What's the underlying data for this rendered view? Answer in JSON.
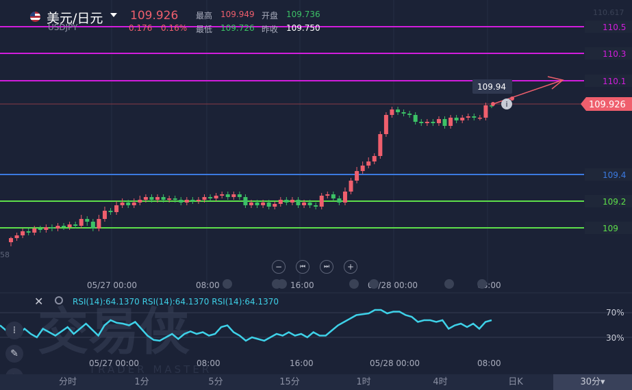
{
  "header": {
    "pair": "美元/日元",
    "symbol": "USDJPY",
    "price": "109.926",
    "change": "0.176",
    "change_pct": "0.16%",
    "high_label": "最高",
    "high_value": "109.949",
    "open_label": "开盘",
    "open_value": "109.736",
    "low_label": "最低",
    "low_value": "109.726",
    "prev_close_label": "昨收",
    "prev_close_value": "109.750"
  },
  "levels": [
    {
      "label": "110.5",
      "color": "#d21ddd"
    },
    {
      "label": "110.3",
      "color": "#d21ddd"
    },
    {
      "label": "110.1",
      "color": "#d21ddd"
    },
    {
      "label": "109.4",
      "color": "#3b7ae0"
    },
    {
      "label": "109.2",
      "color": "#5ee04a"
    },
    {
      "label": "109",
      "color": "#5ee04a"
    }
  ],
  "top_partial_label": "110.617",
  "left_partial_label": "58",
  "current_price_badge": "109.926",
  "arrow_tooltip": "109.94",
  "time_axis_main": [
    "05/27 00:00",
    "08:00",
    "16:00",
    "05/28 00:00",
    "08:00"
  ],
  "time_axis_rsi": [
    "05/27 00:00",
    "08:00",
    "16:00",
    "05/28 00:00",
    "08:00"
  ],
  "rsi": {
    "legend": [
      "RSI(14):64.1370",
      "RSI(14):64.1370",
      "RSI(14):64.1370"
    ],
    "level_70": "70%",
    "level_30": "30%"
  },
  "zoom_controls": {
    "zoom_out": "−",
    "prev": "⏮",
    "next": "⏭",
    "zoom_in": "+"
  },
  "watermark": {
    "main": "交易侠",
    "sub": "TRADER MASTER"
  },
  "tabs": [
    {
      "label": "分时"
    },
    {
      "label": "1分"
    },
    {
      "label": "5分"
    },
    {
      "label": "15分"
    },
    {
      "label": "1时"
    },
    {
      "label": "4时"
    },
    {
      "label": "日K"
    },
    {
      "label": "30分▾",
      "active": true
    }
  ],
  "chart_data": {
    "type": "candlestick",
    "y_range": [
      108.95,
      110.62
    ],
    "rsi_range": [
      20,
      100
    ],
    "candles": [
      [
        108.93,
        108.96,
        108.9,
        108.97
      ],
      [
        108.96,
        108.98,
        108.94,
        109.0
      ],
      [
        108.98,
        109.01,
        108.96,
        109.03
      ],
      [
        109.01,
        109.0,
        108.98,
        109.03
      ],
      [
        109.0,
        109.03,
        108.98,
        109.05
      ],
      [
        109.03,
        109.02,
        109.0,
        109.05
      ],
      [
        109.02,
        109.04,
        109.0,
        109.06
      ],
      [
        109.04,
        109.03,
        109.01,
        109.06
      ],
      [
        109.03,
        109.05,
        109.01,
        109.07
      ],
      [
        109.05,
        109.04,
        109.02,
        109.07
      ],
      [
        109.04,
        109.06,
        109.02,
        109.08
      ],
      [
        109.06,
        109.05,
        109.03,
        109.08
      ],
      [
        109.05,
        109.1,
        109.03,
        109.13
      ],
      [
        109.1,
        109.08,
        109.05,
        109.12
      ],
      [
        109.08,
        109.03,
        109.01,
        109.1
      ],
      [
        109.03,
        109.1,
        109.01,
        109.13
      ],
      [
        109.1,
        109.16,
        109.08,
        109.19
      ],
      [
        109.16,
        109.15,
        109.13,
        109.18
      ],
      [
        109.15,
        109.2,
        109.13,
        109.23
      ],
      [
        109.2,
        109.22,
        109.18,
        109.25
      ],
      [
        109.22,
        109.2,
        109.18,
        109.24
      ],
      [
        109.2,
        109.22,
        109.18,
        109.25
      ],
      [
        109.22,
        109.24,
        109.2,
        109.27
      ],
      [
        109.24,
        109.26,
        109.22,
        109.28
      ],
      [
        109.26,
        109.24,
        109.22,
        109.28
      ],
      [
        109.24,
        109.26,
        109.22,
        109.28
      ],
      [
        109.26,
        109.24,
        109.22,
        109.28
      ],
      [
        109.24,
        109.25,
        109.22,
        109.27
      ],
      [
        109.25,
        109.24,
        109.22,
        109.27
      ],
      [
        109.24,
        109.22,
        109.2,
        109.26
      ],
      [
        109.22,
        109.24,
        109.2,
        109.26
      ],
      [
        109.24,
        109.23,
        109.21,
        109.26
      ],
      [
        109.23,
        109.24,
        109.21,
        109.26
      ],
      [
        109.24,
        109.26,
        109.22,
        109.28
      ],
      [
        109.26,
        109.25,
        109.23,
        109.28
      ],
      [
        109.25,
        109.27,
        109.23,
        109.29
      ],
      [
        109.27,
        109.28,
        109.25,
        109.3
      ],
      [
        109.28,
        109.26,
        109.24,
        109.3
      ],
      [
        109.26,
        109.28,
        109.24,
        109.3
      ],
      [
        109.28,
        109.26,
        109.24,
        109.3
      ],
      [
        109.26,
        109.2,
        109.18,
        109.28
      ],
      [
        109.2,
        109.22,
        109.18,
        109.24
      ],
      [
        109.22,
        109.2,
        109.18,
        109.24
      ],
      [
        109.2,
        109.22,
        109.18,
        109.24
      ],
      [
        109.22,
        109.19,
        109.17,
        109.24
      ],
      [
        109.19,
        109.21,
        109.17,
        109.23
      ],
      [
        109.21,
        109.24,
        109.19,
        109.26
      ],
      [
        109.24,
        109.22,
        109.2,
        109.26
      ],
      [
        109.22,
        109.24,
        109.2,
        109.26
      ],
      [
        109.24,
        109.2,
        109.18,
        109.26
      ],
      [
        109.2,
        109.22,
        109.18,
        109.24
      ],
      [
        109.22,
        109.2,
        109.18,
        109.24
      ],
      [
        109.2,
        109.19,
        109.17,
        109.22
      ],
      [
        109.19,
        109.27,
        109.17,
        109.29
      ],
      [
        109.27,
        109.28,
        109.25,
        109.3
      ],
      [
        109.28,
        109.25,
        109.23,
        109.3
      ],
      [
        109.25,
        109.22,
        109.2,
        109.27
      ],
      [
        109.22,
        109.3,
        109.2,
        109.33
      ],
      [
        109.3,
        109.38,
        109.28,
        109.4
      ],
      [
        109.38,
        109.45,
        109.36,
        109.48
      ],
      [
        109.45,
        109.49,
        109.43,
        109.52
      ],
      [
        109.49,
        109.52,
        109.47,
        109.55
      ],
      [
        109.52,
        109.56,
        109.5,
        109.58
      ],
      [
        109.56,
        109.72,
        109.54,
        109.74
      ],
      [
        109.72,
        109.86,
        109.7,
        109.88
      ],
      [
        109.86,
        109.9,
        109.84,
        109.92
      ],
      [
        109.9,
        109.88,
        109.86,
        109.92
      ],
      [
        109.88,
        109.87,
        109.85,
        109.9
      ],
      [
        109.87,
        109.86,
        109.84,
        109.89
      ],
      [
        109.86,
        109.81,
        109.79,
        109.88
      ],
      [
        109.81,
        109.8,
        109.78,
        109.83
      ],
      [
        109.8,
        109.81,
        109.78,
        109.83
      ],
      [
        109.81,
        109.8,
        109.78,
        109.83
      ],
      [
        109.8,
        109.83,
        109.78,
        109.85
      ],
      [
        109.83,
        109.78,
        109.76,
        109.85
      ],
      [
        109.78,
        109.84,
        109.76,
        109.86
      ],
      [
        109.84,
        109.82,
        109.8,
        109.86
      ],
      [
        109.82,
        109.84,
        109.8,
        109.86
      ],
      [
        109.84,
        109.85,
        109.82,
        109.87
      ],
      [
        109.85,
        109.84,
        109.82,
        109.87
      ],
      [
        109.84,
        109.84,
        109.82,
        109.86
      ],
      [
        109.84,
        109.93,
        109.82,
        109.95
      ],
      [
        109.93,
        109.926,
        109.91,
        109.949
      ]
    ],
    "rsi_values": [
      62,
      56,
      48,
      52,
      58,
      52,
      48,
      58,
      54,
      50,
      55,
      60,
      52,
      58,
      64,
      57,
      50,
      62,
      68,
      65,
      64,
      62,
      66,
      58,
      50,
      45,
      44,
      48,
      52,
      46,
      52,
      55,
      52,
      54,
      50,
      52,
      60,
      62,
      54,
      50,
      44,
      48,
      46,
      44,
      48,
      52,
      50,
      54,
      50,
      52,
      48,
      54,
      50,
      50,
      56,
      62,
      66,
      70,
      74,
      75,
      76,
      80,
      80,
      76,
      78,
      78,
      74,
      72,
      66,
      68,
      68,
      66,
      68,
      58,
      62,
      64,
      60,
      64,
      58,
      66,
      68
    ]
  }
}
